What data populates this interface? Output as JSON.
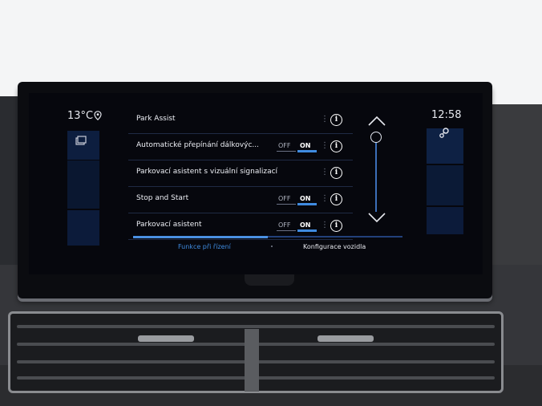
{
  "status": {
    "temperature": "13°C",
    "time": "12:58"
  },
  "settings_list": [
    {
      "label": "Park Assist",
      "has_toggle": false
    },
    {
      "label": "Automatické přepínání dálkovýc...",
      "has_toggle": true,
      "off_label": "OFF",
      "on_label": "ON",
      "state": "ON"
    },
    {
      "label": "Parkovací asistent s vizuální signalizací",
      "has_toggle": false
    },
    {
      "label": "Stop and Start",
      "has_toggle": true,
      "off_label": "OFF",
      "on_label": "ON",
      "state": "ON"
    },
    {
      "label": "Parkovací asistent",
      "has_toggle": true,
      "off_label": "OFF",
      "on_label": "ON",
      "state": "ON"
    }
  ],
  "info_glyph": "i",
  "separator": "⋮",
  "tabs": [
    {
      "label": "Funkce při řízení",
      "active": true
    },
    {
      "label": "Konfigurace vozidla",
      "active": false
    }
  ],
  "colors": {
    "accent": "#3f8be0",
    "panel": "#0d1e3f",
    "text": "#eef0f6"
  },
  "icons": {
    "location": "location-pin-icon",
    "menu": "menu-icon",
    "settings": "settings-icon",
    "scroll_up": "chevron-up-icon",
    "scroll_down": "chevron-down-icon",
    "info": "info-icon"
  }
}
